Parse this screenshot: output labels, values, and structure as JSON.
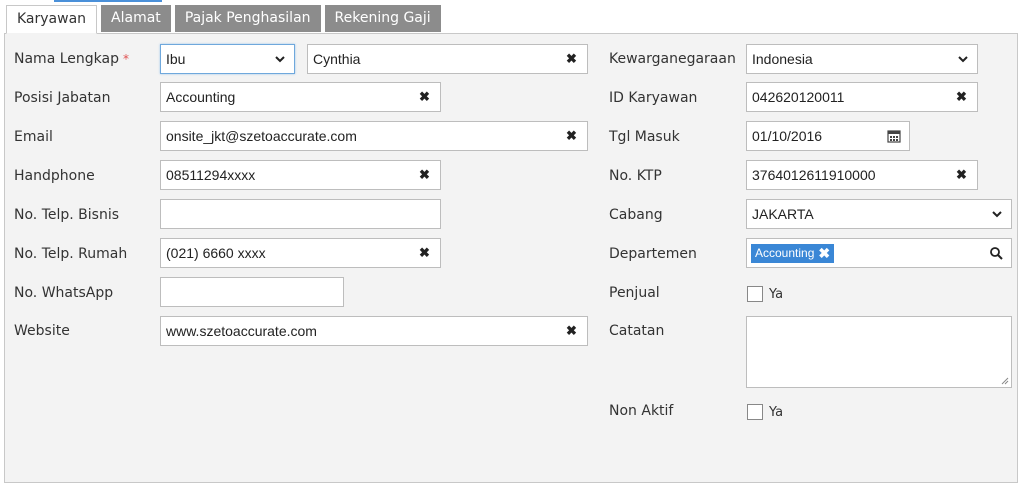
{
  "tabs": [
    {
      "label": "Karyawan",
      "active": true
    },
    {
      "label": "Alamat",
      "active": false
    },
    {
      "label": "Pajak Penghasilan",
      "active": false
    },
    {
      "label": "Rekening Gaji",
      "active": false
    }
  ],
  "left": {
    "nama_lengkap": {
      "label": "Nama Lengkap",
      "required": "*",
      "salutation": "Ibu",
      "value": "Cynthia"
    },
    "posisi_jabatan": {
      "label": "Posisi Jabatan",
      "value": "Accounting"
    },
    "email": {
      "label": "Email",
      "value": "onsite_jkt@szetoaccurate.com"
    },
    "handphone": {
      "label": "Handphone",
      "value": "08511294xxxx"
    },
    "telp_bisnis": {
      "label": "No. Telp. Bisnis",
      "value": ""
    },
    "telp_rumah": {
      "label": "No. Telp. Rumah",
      "value": "(021) 6660 xxxx"
    },
    "whatsapp": {
      "label": "No. WhatsApp",
      "value": ""
    },
    "website": {
      "label": "Website",
      "value": "www.szetoaccurate.com"
    }
  },
  "right": {
    "kewarganegaraan": {
      "label": "Kewarganegaraan",
      "value": "Indonesia"
    },
    "id_karyawan": {
      "label": "ID Karyawan",
      "value": "042620120011"
    },
    "tgl_masuk": {
      "label": "Tgl Masuk",
      "value": "01/10/2016"
    },
    "no_ktp": {
      "label": "No. KTP",
      "value": "3764012611910000"
    },
    "cabang": {
      "label": "Cabang",
      "value": "JAKARTA"
    },
    "departemen": {
      "label": "Departemen",
      "tag": "Accounting"
    },
    "penjual": {
      "label": "Penjual",
      "checkbox_label": "Ya",
      "checked": false
    },
    "catatan": {
      "label": "Catatan",
      "value": ""
    },
    "non_aktif": {
      "label": "Non Aktif",
      "checkbox_label": "Ya",
      "checked": false
    }
  },
  "icons": {
    "clear": "✖",
    "dropdown": "chevron-down-icon",
    "calendar": "calendar-icon",
    "search": "search-icon"
  },
  "colors": {
    "tab_inactive": "#8c8c8c",
    "panel": "#f3f3f3",
    "tag": "#3a87d6",
    "required": "#e05050",
    "focus": "#6fa8dc"
  }
}
